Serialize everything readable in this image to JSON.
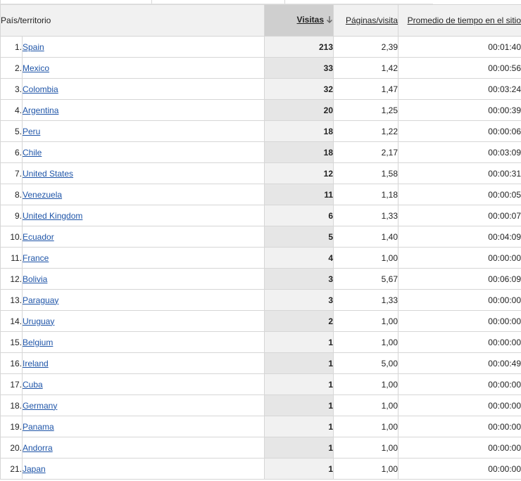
{
  "header": {
    "country": "País/territorio",
    "visits": "Visitas",
    "pages": "Páginas/visita",
    "time": "Promedio de tiempo en el sitio",
    "sort_icon": "arrow-down-icon"
  },
  "rows": [
    {
      "rank": "1.",
      "name": "Spain",
      "visits": "213",
      "pages": "2,39",
      "time": "00:01:40"
    },
    {
      "rank": "2.",
      "name": "Mexico",
      "visits": "33",
      "pages": "1,42",
      "time": "00:00:56"
    },
    {
      "rank": "3.",
      "name": "Colombia",
      "visits": "32",
      "pages": "1,47",
      "time": "00:03:24"
    },
    {
      "rank": "4.",
      "name": "Argentina",
      "visits": "20",
      "pages": "1,25",
      "time": "00:00:39"
    },
    {
      "rank": "5.",
      "name": "Peru",
      "visits": "18",
      "pages": "1,22",
      "time": "00:00:06"
    },
    {
      "rank": "6.",
      "name": "Chile",
      "visits": "18",
      "pages": "2,17",
      "time": "00:03:09"
    },
    {
      "rank": "7.",
      "name": "United States",
      "visits": "12",
      "pages": "1,58",
      "time": "00:00:31"
    },
    {
      "rank": "8.",
      "name": "Venezuela",
      "visits": "11",
      "pages": "1,18",
      "time": "00:00:05"
    },
    {
      "rank": "9.",
      "name": "United Kingdom",
      "visits": "6",
      "pages": "1,33",
      "time": "00:00:07"
    },
    {
      "rank": "10.",
      "name": "Ecuador",
      "visits": "5",
      "pages": "1,40",
      "time": "00:04:09"
    },
    {
      "rank": "11.",
      "name": "France",
      "visits": "4",
      "pages": "1,00",
      "time": "00:00:00"
    },
    {
      "rank": "12.",
      "name": "Bolivia",
      "visits": "3",
      "pages": "5,67",
      "time": "00:06:09"
    },
    {
      "rank": "13.",
      "name": "Paraguay",
      "visits": "3",
      "pages": "1,33",
      "time": "00:00:00"
    },
    {
      "rank": "14.",
      "name": "Uruguay",
      "visits": "2",
      "pages": "1,00",
      "time": "00:00:00"
    },
    {
      "rank": "15.",
      "name": "Belgium",
      "visits": "1",
      "pages": "1,00",
      "time": "00:00:00"
    },
    {
      "rank": "16.",
      "name": "Ireland",
      "visits": "1",
      "pages": "5,00",
      "time": "00:00:49"
    },
    {
      "rank": "17.",
      "name": "Cuba",
      "visits": "1",
      "pages": "1,00",
      "time": "00:00:00"
    },
    {
      "rank": "18.",
      "name": "Germany",
      "visits": "1",
      "pages": "1,00",
      "time": "00:00:00"
    },
    {
      "rank": "19.",
      "name": "Panama",
      "visits": "1",
      "pages": "1,00",
      "time": "00:00:00"
    },
    {
      "rank": "20.",
      "name": "Andorra",
      "visits": "1",
      "pages": "1,00",
      "time": "00:00:00"
    },
    {
      "rank": "21.",
      "name": "Japan",
      "visits": "1",
      "pages": "1,00",
      "time": "00:00:00"
    }
  ]
}
